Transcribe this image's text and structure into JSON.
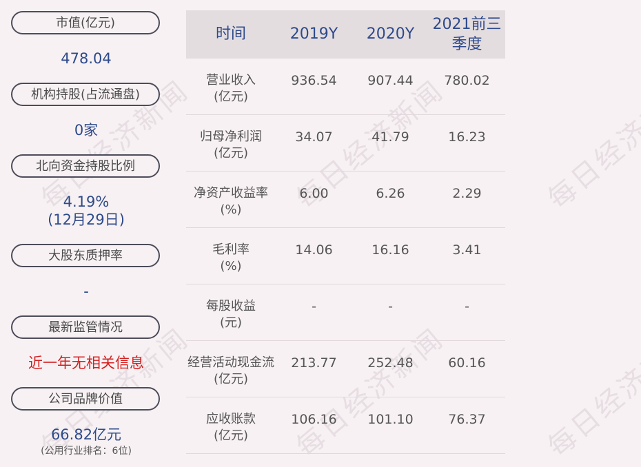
{
  "left_panel": [
    {
      "label": "市值(亿元)",
      "value": "478.04"
    },
    {
      "label": "机构持股(占流通盘)",
      "value": "0家"
    },
    {
      "label": "北向资金持股比例",
      "value": "4.19%",
      "value2": "(12月29日)"
    },
    {
      "label": "大股东质押率",
      "value": "-"
    },
    {
      "label": "最新监管情况",
      "value": "近一年无相关信息"
    },
    {
      "label": "公司品牌价值",
      "value": "66.82亿元",
      "note": "(公用行业排名：6位)"
    }
  ],
  "table": {
    "headers": [
      "时间",
      "2019Y",
      "2020Y",
      "2021前三",
      "季度"
    ],
    "rows": [
      {
        "label1": "营业收入",
        "label2": "(亿元)",
        "values": [
          "936.54",
          "907.44",
          "780.02"
        ]
      },
      {
        "label1": "归母净利润",
        "label2": "(亿元)",
        "values": [
          "34.07",
          "41.79",
          "16.23"
        ]
      },
      {
        "label1": "净资产收益率",
        "label2": "(%)",
        "values": [
          "6.00",
          "6.26",
          "2.29"
        ]
      },
      {
        "label1": "毛利率",
        "label2": "(%)",
        "values": [
          "14.06",
          "16.16",
          "3.41"
        ]
      },
      {
        "label1": "每股收益",
        "label2": "(元)",
        "values": [
          "-",
          "-",
          "-"
        ]
      },
      {
        "label1": "经营活动现金流",
        "label2": "(亿元)",
        "values": [
          "213.77",
          "252.48",
          "60.16"
        ]
      },
      {
        "label1": "应收账款",
        "label2": "(亿元)",
        "values": [
          "106.16",
          "101.10",
          "76.37"
        ]
      }
    ]
  },
  "watermark": "每日经济新闻"
}
